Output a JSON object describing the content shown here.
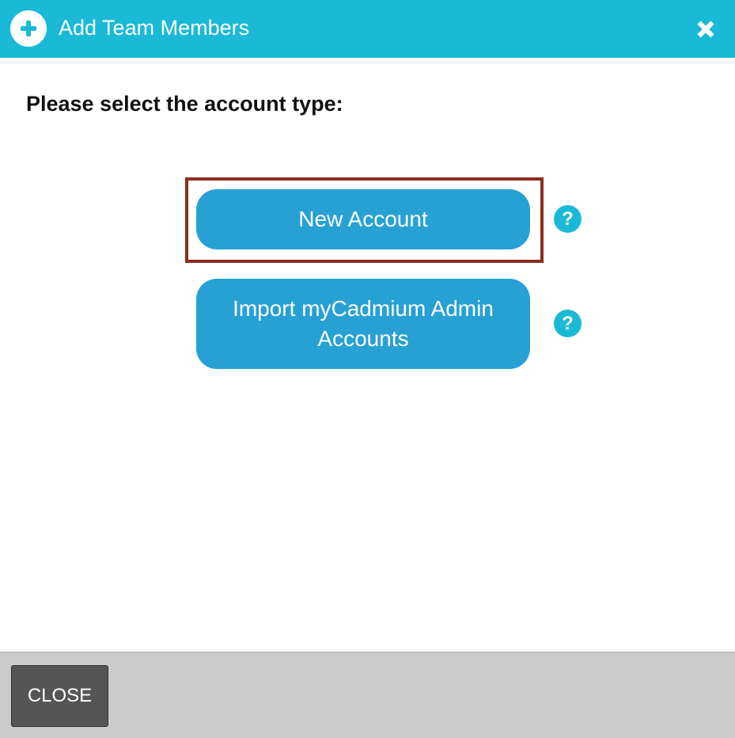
{
  "header": {
    "title": "Add Team Members",
    "background_color": "#1ab9d8",
    "icons": {
      "left": "plus-circle-icon",
      "right": "close-icon"
    }
  },
  "main": {
    "prompt": "Please select the account type:",
    "options": [
      {
        "label": "New Account",
        "help_icon": "question-circle-icon",
        "highlighted": true
      },
      {
        "label": "Import myCadmium Admin Accounts",
        "help_icon": "question-circle-icon",
        "highlighted": false
      }
    ],
    "button_color": "#27a1d4",
    "highlight_color": "#8b2e1e",
    "help_symbol": "?"
  },
  "footer": {
    "close_label": "CLOSE",
    "background_color": "#cbcbcb"
  }
}
